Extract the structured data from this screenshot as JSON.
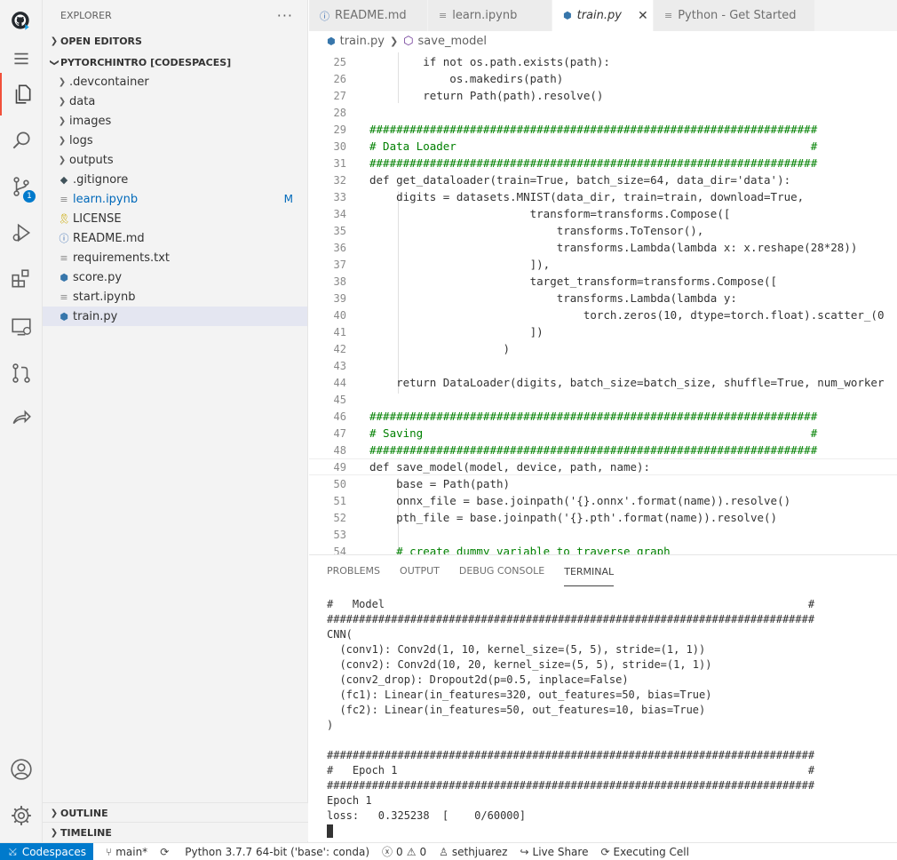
{
  "sidebar": {
    "title": "EXPLORER",
    "more": "···",
    "sections": {
      "open_editors": "OPEN EDITORS",
      "workspace": "PYTORCHINTRO [CODESPACES]",
      "outline": "OUTLINE",
      "timeline": "TIMELINE"
    },
    "items": [
      {
        "label": ".devcontainer",
        "type": "folder"
      },
      {
        "label": "data",
        "type": "folder"
      },
      {
        "label": "images",
        "type": "folder"
      },
      {
        "label": "logs",
        "type": "folder"
      },
      {
        "label": "outputs",
        "type": "folder"
      },
      {
        "label": ".gitignore",
        "type": "git"
      },
      {
        "label": "learn.ipynb",
        "type": "notebook",
        "status": "M"
      },
      {
        "label": "LICENSE",
        "type": "license"
      },
      {
        "label": "README.md",
        "type": "info"
      },
      {
        "label": "requirements.txt",
        "type": "text"
      },
      {
        "label": "score.py",
        "type": "python"
      },
      {
        "label": "start.ipynb",
        "type": "notebook"
      },
      {
        "label": "train.py",
        "type": "python",
        "selected": true
      }
    ]
  },
  "activity": {
    "scm_badge": "1"
  },
  "tabs": [
    {
      "label": "README.md",
      "icon": "info-icon"
    },
    {
      "label": "learn.ipynb",
      "icon": "file-icon"
    },
    {
      "label": "train.py",
      "icon": "python-icon",
      "active": true
    },
    {
      "label": "Python - Get Started",
      "icon": "file-icon"
    }
  ],
  "breadcrumb": {
    "file": "train.py",
    "symbol": "save_model"
  },
  "editor": {
    "lines": [
      {
        "n": "25",
        "code": "        if not os.path.exists(path):"
      },
      {
        "n": "26",
        "code": "            os.makedirs(path)"
      },
      {
        "n": "27",
        "code": "        return Path(path).resolve()"
      },
      {
        "n": "28",
        "code": ""
      },
      {
        "n": "29",
        "code": "###################################################################"
      },
      {
        "n": "30",
        "code": "# Data Loader                                                     #"
      },
      {
        "n": "31",
        "code": "###################################################################"
      },
      {
        "n": "32",
        "code": "def get_dataloader(train=True, batch_size=64, data_dir='data'):"
      },
      {
        "n": "33",
        "code": "    digits = datasets.MNIST(data_dir, train=train, download=True,"
      },
      {
        "n": "34",
        "code": "                        transform=transforms.Compose(["
      },
      {
        "n": "35",
        "code": "                            transforms.ToTensor(),"
      },
      {
        "n": "36",
        "code": "                            transforms.Lambda(lambda x: x.reshape(28*28))"
      },
      {
        "n": "37",
        "code": "                        ]),"
      },
      {
        "n": "38",
        "code": "                        target_transform=transforms.Compose(["
      },
      {
        "n": "39",
        "code": "                            transforms.Lambda(lambda y:"
      },
      {
        "n": "40",
        "code": "                                torch.zeros(10, dtype=torch.float).scatter_(0"
      },
      {
        "n": "41",
        "code": "                        ])"
      },
      {
        "n": "42",
        "code": "                    )"
      },
      {
        "n": "43",
        "code": ""
      },
      {
        "n": "44",
        "code": "    return DataLoader(digits, batch_size=batch_size, shuffle=True, num_worker"
      },
      {
        "n": "45",
        "code": ""
      },
      {
        "n": "46",
        "code": "###################################################################"
      },
      {
        "n": "47",
        "code": "# Saving                                                          #"
      },
      {
        "n": "48",
        "code": "###################################################################"
      },
      {
        "n": "49",
        "code": "def save_model(model, device, path, name):"
      },
      {
        "n": "50",
        "code": "    base = Path(path)"
      },
      {
        "n": "51",
        "code": "    onnx_file = base.joinpath('{}.onnx'.format(name)).resolve()"
      },
      {
        "n": "52",
        "code": "    pth_file = base.joinpath('{}.pth'.format(name)).resolve()"
      },
      {
        "n": "53",
        "code": ""
      },
      {
        "n": "54",
        "code": "    # create dummy variable to traverse graph"
      }
    ]
  },
  "panel": {
    "tabs": [
      "PROBLEMS",
      "OUTPUT",
      "DEBUG CONSOLE",
      "TERMINAL"
    ],
    "terminal_lines": [
      "#   Model                                                                  #",
      "############################################################################",
      "CNN(",
      "  (conv1): Conv2d(1, 10, kernel_size=(5, 5), stride=(1, 1))",
      "  (conv2): Conv2d(10, 20, kernel_size=(5, 5), stride=(1, 1))",
      "  (conv2_drop): Dropout2d(p=0.5, inplace=False)",
      "  (fc1): Linear(in_features=320, out_features=50, bias=True)",
      "  (fc2): Linear(in_features=50, out_features=10, bias=True)",
      ")",
      "",
      "############################################################################",
      "#   Epoch 1                                                                #",
      "############################################################################",
      "Epoch 1",
      "loss:   0.325238  [    0/60000]"
    ]
  },
  "statusbar": {
    "remote": "Codespaces",
    "branch": "main*",
    "python": "Python 3.7.7 64-bit ('base': conda)",
    "errors": "0",
    "warnings": "0",
    "user": "sethjuarez",
    "liveshare": "Live Share",
    "executing": "Executing Cell"
  }
}
